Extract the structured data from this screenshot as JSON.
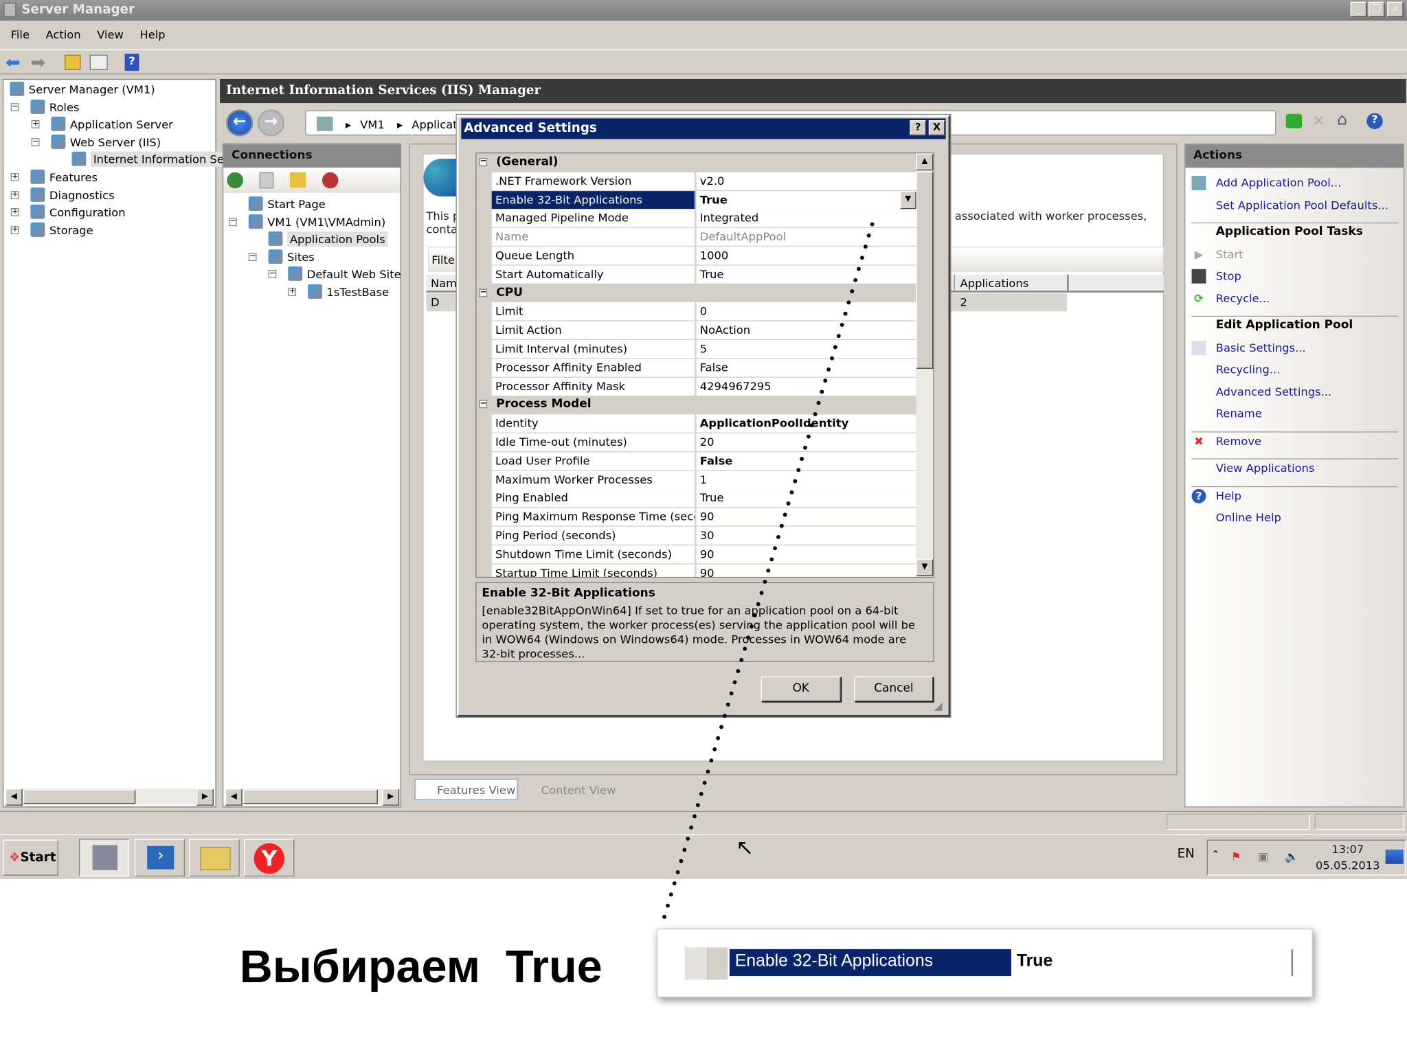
{
  "window": {
    "title": "Server Manager",
    "menu": [
      "File",
      "Action",
      "View",
      "Help"
    ]
  },
  "left_tree": [
    {
      "label": "Server Manager (VM1)",
      "indent": 0,
      "expander": ""
    },
    {
      "label": "Roles",
      "indent": 1,
      "expander": "−"
    },
    {
      "label": "Application Server",
      "indent": 2,
      "expander": "+"
    },
    {
      "label": "Web Server (IIS)",
      "indent": 2,
      "expander": "−"
    },
    {
      "label": "Internet Information Se",
      "indent": 3,
      "expander": "",
      "selected": true
    },
    {
      "label": "Features",
      "indent": 1,
      "expander": "+"
    },
    {
      "label": "Diagnostics",
      "indent": 1,
      "expander": "+"
    },
    {
      "label": "Configuration",
      "indent": 1,
      "expander": "+"
    },
    {
      "label": "Storage",
      "indent": 1,
      "expander": "+"
    }
  ],
  "iis": {
    "title": "Internet Information Services (IIS) Manager",
    "breadcrumb": [
      "VM1",
      "Applicatio"
    ]
  },
  "connections": {
    "title": "Connections",
    "tree": [
      {
        "label": "Start Page",
        "indent": 1,
        "expander": ""
      },
      {
        "label": "VM1 (VM1\\VMAdmin)",
        "indent": 1,
        "expander": "−"
      },
      {
        "label": "Application Pools",
        "indent": 2,
        "expander": "",
        "selected": true
      },
      {
        "label": "Sites",
        "indent": 2,
        "expander": "−"
      },
      {
        "label": "Default Web Site",
        "indent": 3,
        "expander": "−"
      },
      {
        "label": "1sTestBase",
        "indent": 4,
        "expander": "+"
      }
    ]
  },
  "center": {
    "text_left_1": "This p",
    "text_left_2": "contai",
    "text_right": "associated with worker processes,",
    "filter": "Filter",
    "col_name": "Name",
    "col_apps": "Applications",
    "row_name": "D",
    "row_apps": "2",
    "tab_features": "Features View",
    "tab_content": "Content View"
  },
  "actions": {
    "title": "Actions",
    "items": [
      {
        "label": "Add Application Pool...",
        "type": "link",
        "icon": "add-pool-icon"
      },
      {
        "label": "Set Application Pool Defaults...",
        "type": "link"
      },
      {
        "type": "sep"
      },
      {
        "label": "Application Pool Tasks",
        "type": "header"
      },
      {
        "label": "Start",
        "type": "disabled",
        "icon": "play-icon"
      },
      {
        "label": "Stop",
        "type": "link",
        "icon": "stop-icon"
      },
      {
        "label": "Recycle...",
        "type": "link",
        "icon": "recycle-icon"
      },
      {
        "type": "sep"
      },
      {
        "label": "Edit Application Pool",
        "type": "header"
      },
      {
        "label": "Basic Settings...",
        "type": "link",
        "icon": "settings-icon"
      },
      {
        "label": "Recycling...",
        "type": "link"
      },
      {
        "label": "Advanced Settings...",
        "type": "link"
      },
      {
        "label": "Rename",
        "type": "link"
      },
      {
        "type": "sep"
      },
      {
        "label": "Remove",
        "type": "link",
        "icon": "remove-icon"
      },
      {
        "type": "sep"
      },
      {
        "label": "View Applications",
        "type": "link"
      },
      {
        "type": "sep"
      },
      {
        "label": "Help",
        "type": "link",
        "icon": "help-icon"
      },
      {
        "label": "Online Help",
        "type": "link"
      }
    ]
  },
  "dialog": {
    "title": "Advanced Settings",
    "help": "?",
    "close": "X",
    "rows": [
      {
        "cat": "(General)"
      },
      {
        "name": ".NET Framework Version",
        "value": "v2.0"
      },
      {
        "name": "Enable 32-Bit Applications",
        "value": "True",
        "selected": true,
        "bold": true,
        "dropdown": true
      },
      {
        "name": "Managed Pipeline Mode",
        "value": "Integrated"
      },
      {
        "name": "Name",
        "value": "DefaultAppPool",
        "disabled": true
      },
      {
        "name": "Queue Length",
        "value": "1000"
      },
      {
        "name": "Start Automatically",
        "value": "True"
      },
      {
        "cat": "CPU"
      },
      {
        "name": "Limit",
        "value": "0"
      },
      {
        "name": "Limit Action",
        "value": "NoAction"
      },
      {
        "name": "Limit Interval (minutes)",
        "value": "5"
      },
      {
        "name": "Processor Affinity Enabled",
        "value": "False"
      },
      {
        "name": "Processor Affinity Mask",
        "value": "4294967295"
      },
      {
        "cat": "Process Model"
      },
      {
        "name": "Identity",
        "value": "ApplicationPoolIdentity",
        "bold": true
      },
      {
        "name": "Idle Time-out (minutes)",
        "value": "20"
      },
      {
        "name": "Load User Profile",
        "value": "False",
        "bold": true
      },
      {
        "name": "Maximum Worker Processes",
        "value": "1"
      },
      {
        "name": "Ping Enabled",
        "value": "True"
      },
      {
        "name": "Ping Maximum Response Time (seconds)",
        "value": "90"
      },
      {
        "name": "Ping Period (seconds)",
        "value": "30"
      },
      {
        "name": "Shutdown Time Limit (seconds)",
        "value": "90"
      },
      {
        "name": "Startup Time Limit (seconds)",
        "value": "90"
      }
    ],
    "desc_title": "Enable 32-Bit Applications",
    "desc_text": "[enable32BitAppOnWin64] If set to true for an application pool on a 64-bit operating system, the worker process(es) serving the application pool will be in WOW64 (Windows on Windows64) mode. Processes in WOW64 mode are 32-bit processes...",
    "ok": "OK",
    "cancel": "Cancel"
  },
  "taskbar": {
    "start": "Start",
    "lang": "EN",
    "time": "13:07",
    "date": "05.05.2013"
  },
  "annotation": {
    "caption": "Выбираем  True",
    "zoom_name": "Enable 32-Bit Applications",
    "zoom_value": "True"
  },
  "colors": {
    "selection": "#0a246a",
    "link": "#1a1a9a",
    "panel_header": "#8b8b8b",
    "iis_header": "#3a3a3a"
  }
}
